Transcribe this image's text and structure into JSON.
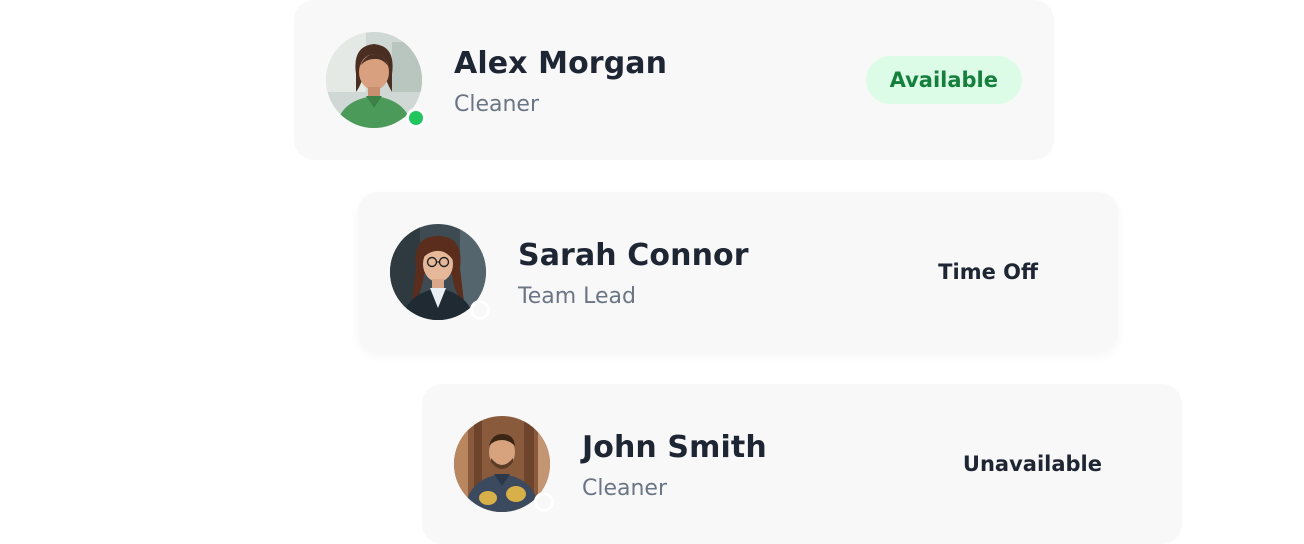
{
  "members": [
    {
      "name": "Alex Morgan",
      "role": "Cleaner",
      "status": "Available",
      "presence": "online",
      "avatar_icon": "person-avatar-green-uniform"
    },
    {
      "name": "Sarah Connor",
      "role": "Team Lead",
      "status": "Time Off",
      "presence": "offline",
      "avatar_icon": "person-avatar-blazer-glasses"
    },
    {
      "name": "John Smith",
      "role": "Cleaner",
      "status": "Unavailable",
      "presence": "offline",
      "avatar_icon": "person-avatar-denim-gloves"
    }
  ],
  "colors": {
    "card_bg": "#f8f8f8",
    "name_text": "#1e2533",
    "role_text": "#6b7585",
    "available_bg": "#dcfce7",
    "available_text": "#15803d",
    "online_dot": "#22c55e"
  }
}
